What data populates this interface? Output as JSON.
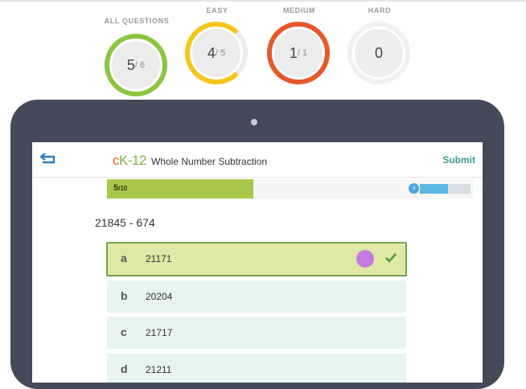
{
  "stats": [
    {
      "label": "ALL QUESTIONS",
      "value": "5",
      "total": "/ 6",
      "progress": 0.83,
      "color": "#8cc63f"
    },
    {
      "label": "EASY",
      "value": "4",
      "total": "/ 5",
      "progress": 0.8,
      "color": "#f5c518"
    },
    {
      "label": "MEDIUM",
      "value": "1",
      "total": "/ 1",
      "progress": 1.0,
      "color": "#e8572a"
    },
    {
      "label": "HARD",
      "value": "0",
      "total": "",
      "progress": 0,
      "color": "#eeeeee"
    }
  ],
  "app": {
    "logo_c": "c",
    "logo_k": "K",
    "logo_dash": "-12",
    "title": "Whole Number Subtraction",
    "submit": "Submit"
  },
  "progress": {
    "current": "5",
    "total": "/10",
    "fraction": 0.4,
    "meter_fraction": 0.55
  },
  "question": {
    "text": "21845 - 674"
  },
  "options": [
    {
      "letter": "a",
      "value": "21171",
      "selected": true
    },
    {
      "letter": "b",
      "value": "20204",
      "selected": false
    },
    {
      "letter": "c",
      "value": "21717",
      "selected": false
    },
    {
      "letter": "d",
      "value": "21211",
      "selected": false
    }
  ],
  "icons": {
    "back": "back-arrow-icon",
    "bolt": "bolt-icon",
    "check": "check-icon"
  }
}
